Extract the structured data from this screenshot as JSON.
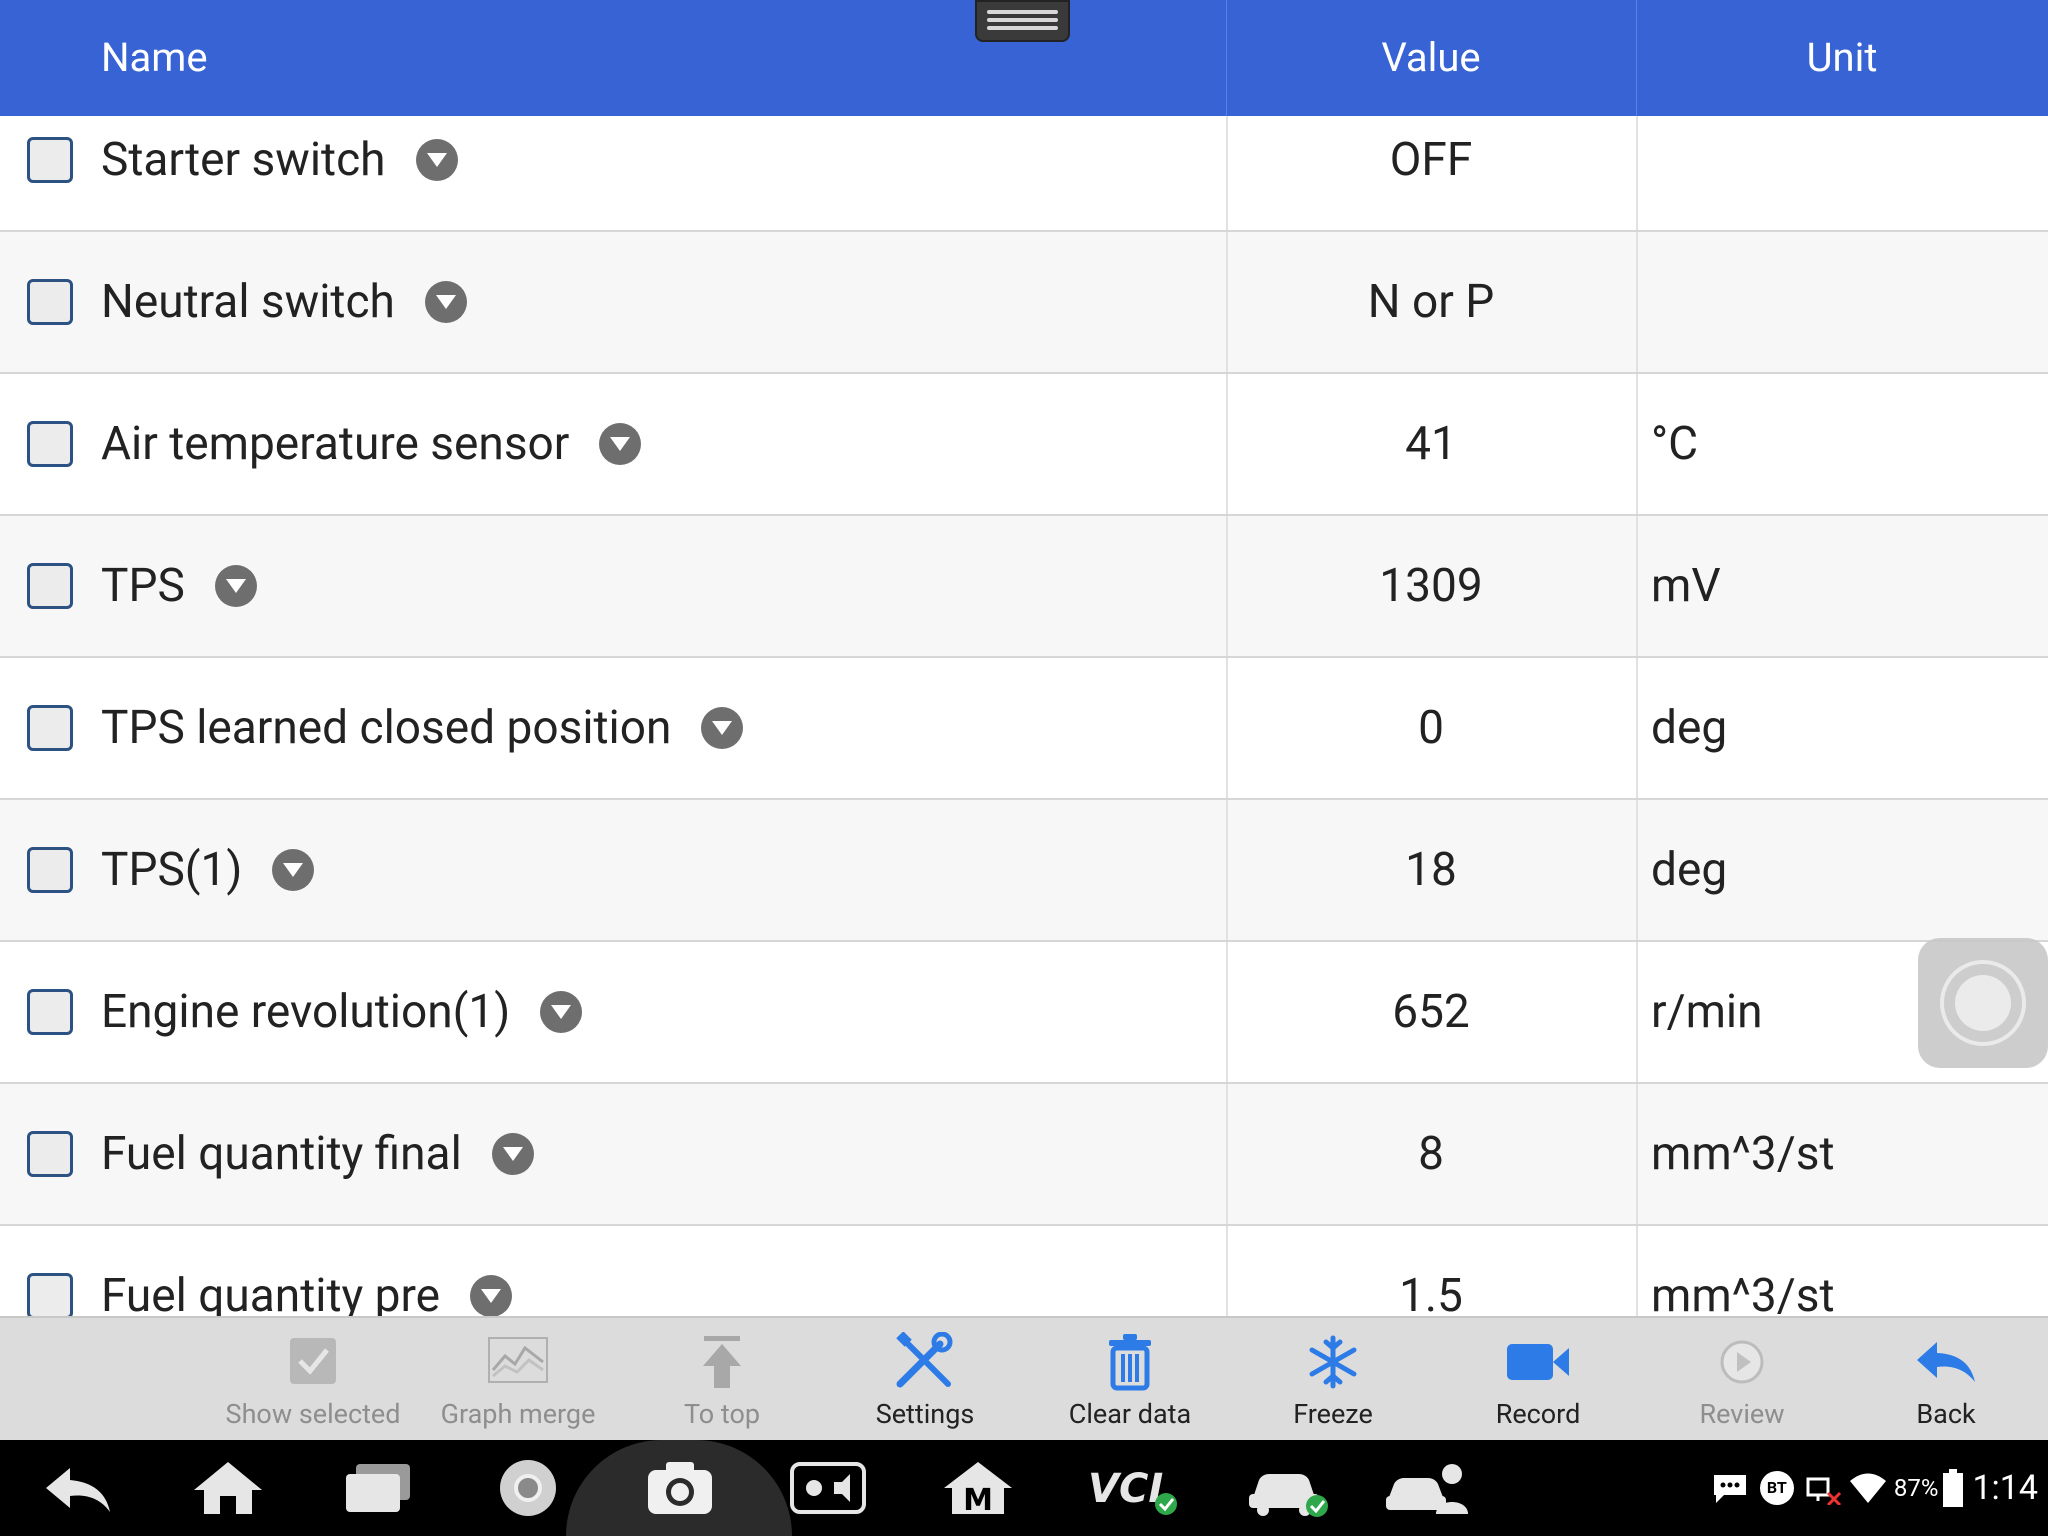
{
  "header": {
    "col_name": "Name",
    "col_value": "Value",
    "col_unit": "Unit"
  },
  "rows": [
    {
      "name": "Starter switch",
      "value": "OFF",
      "unit": ""
    },
    {
      "name": "Neutral switch",
      "value": "N or P",
      "unit": ""
    },
    {
      "name": "Air temperature sensor",
      "value": "41",
      "unit": "°C"
    },
    {
      "name": "TPS",
      "value": "1309",
      "unit": "mV"
    },
    {
      "name": "TPS learned closed position",
      "value": "0",
      "unit": "deg"
    },
    {
      "name": "TPS(1)",
      "value": "18",
      "unit": "deg"
    },
    {
      "name": "Engine revolution(1)",
      "value": "652",
      "unit": "r/min"
    },
    {
      "name": "Fuel quantity final",
      "value": "8",
      "unit": "mm^3/st"
    },
    {
      "name": "Fuel quantity pre",
      "value": "1.5",
      "unit": "mm^3/st"
    }
  ],
  "toolbar": {
    "show_selected": "Show selected",
    "graph_merge": "Graph merge",
    "to_top": "To top",
    "settings": "Settings",
    "clear_data": "Clear data",
    "freeze": "Freeze",
    "record": "Record",
    "review": "Review",
    "back": "Back"
  },
  "status_bar": {
    "bt": "BT",
    "battery": "87%",
    "time": "1:14"
  },
  "colors": {
    "header": "#3763d4",
    "accent_blue": "#2d7be6",
    "disabled": "#9a9a9a"
  }
}
